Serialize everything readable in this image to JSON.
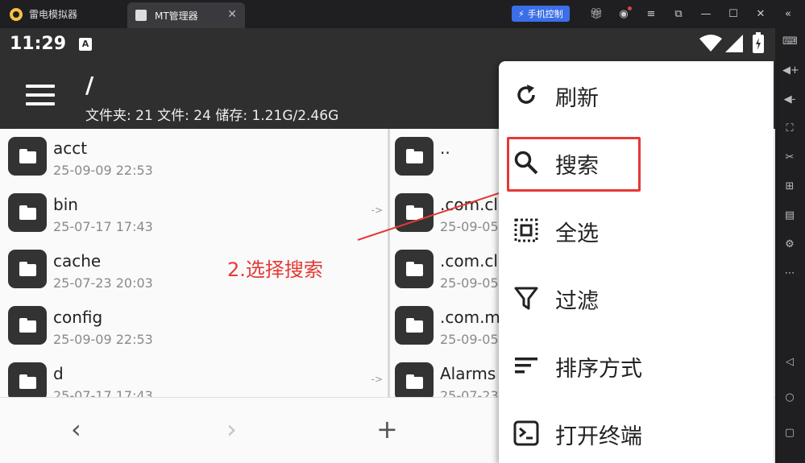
{
  "titlebar": {
    "home_tab": "雷电模拟器",
    "active_tab": "MT管理器",
    "close_glyph": "✕",
    "phone_control": "手机控制"
  },
  "statusbar": {
    "time": "11:29",
    "notif_letter": "A"
  },
  "appbar": {
    "path": "/",
    "stats": "文件夹: 21  文件: 24  储存: 1.21G/2.46G"
  },
  "left_panel": [
    {
      "name": "acct",
      "date": "25-09-09 22:53",
      "link": ""
    },
    {
      "name": "bin",
      "date": "25-07-17 17:43",
      "link": "->"
    },
    {
      "name": "cache",
      "date": "25-07-23 20:03",
      "link": ""
    },
    {
      "name": "config",
      "date": "25-09-09 22:53",
      "link": ""
    },
    {
      "name": "d",
      "date": "25-07-17 17:43",
      "link": "->"
    }
  ],
  "right_panel": [
    {
      "name": "..",
      "date": ""
    },
    {
      "name": ".com.cl",
      "date": "25-09-05"
    },
    {
      "name": ".com.cl",
      "date": "25-09-05"
    },
    {
      "name": ".com.m",
      "date": "25-09-05"
    },
    {
      "name": "Alarms",
      "date": "25-07-23"
    }
  ],
  "bottombar": {
    "back": "‹",
    "forward": "›",
    "add": "+"
  },
  "menu": {
    "items": [
      {
        "label": "刷新",
        "icon": "refresh-icon"
      },
      {
        "label": "搜索",
        "icon": "search-icon"
      },
      {
        "label": "全选",
        "icon": "select-all-icon"
      },
      {
        "label": "过滤",
        "icon": "filter-icon"
      },
      {
        "label": "排序方式",
        "icon": "sort-icon"
      },
      {
        "label": "打开终端",
        "icon": "terminal-icon"
      }
    ]
  },
  "annotation": {
    "text": "2.选择搜索",
    "color": "#e53935"
  },
  "colors": {
    "appbar": "#2f2f2f",
    "accent_blue": "#3b6fe8",
    "highlight_red": "#e53935"
  }
}
